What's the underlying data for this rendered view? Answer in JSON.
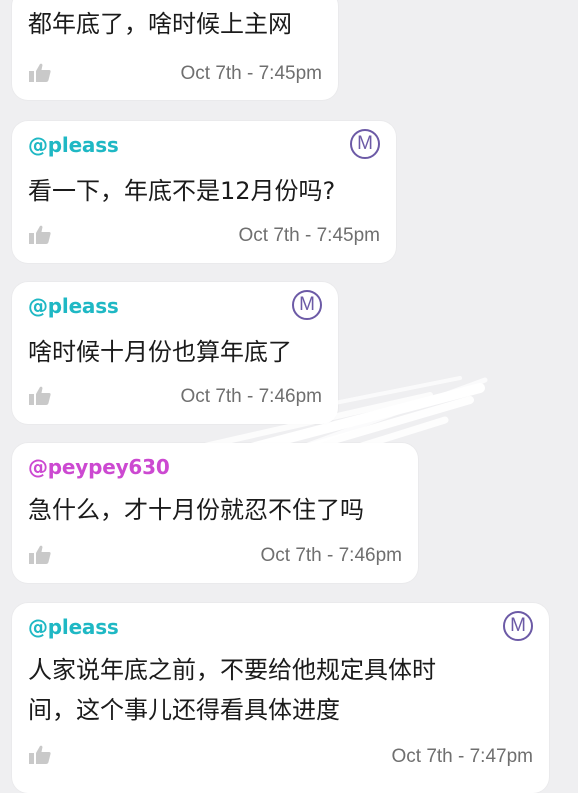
{
  "colors": {
    "background": "#efeff1",
    "bubble": "#ffffff",
    "sender_pleass": "#1fb8c4",
    "sender_peypey": "#cc49d1",
    "moderator_badge": "#6c5aa6",
    "timestamp": "#6f6f6f",
    "like_icon": "#c9c9c9"
  },
  "messages": [
    {
      "sender": "",
      "text_lines": [
        "都年底了，啥时候上主网"
      ],
      "timestamp": "Oct 7th - 7:45pm",
      "moderator": false,
      "icons": [
        "thumbs-up-icon"
      ]
    },
    {
      "sender": "@pleass",
      "text_lines": [
        "看一下，年底不是12月份吗?"
      ],
      "timestamp": "Oct 7th - 7:45pm",
      "moderator": true,
      "badge_letter": "M",
      "icons": [
        "thumbs-up-icon",
        "moderator-badge-icon"
      ]
    },
    {
      "sender": "@pleass",
      "text_lines": [
        "啥时候十月份也算年底了"
      ],
      "timestamp": "Oct 7th - 7:46pm",
      "moderator": true,
      "badge_letter": "M",
      "icons": [
        "thumbs-up-icon",
        "moderator-badge-icon"
      ]
    },
    {
      "sender": "@peypey630",
      "text_lines": [
        "急什么，才十月份就忍不住了吗"
      ],
      "timestamp": "Oct 7th - 7:46pm",
      "moderator": false,
      "icons": [
        "thumbs-up-icon"
      ]
    },
    {
      "sender": "@pleass",
      "text_lines": [
        "人家说年底之前，不要给他规定具体时",
        "间，这个事儿还得看具体进度"
      ],
      "timestamp": "Oct 7th - 7:47pm",
      "moderator": true,
      "badge_letter": "M",
      "icons": [
        "thumbs-up-icon",
        "moderator-badge-icon"
      ]
    }
  ]
}
